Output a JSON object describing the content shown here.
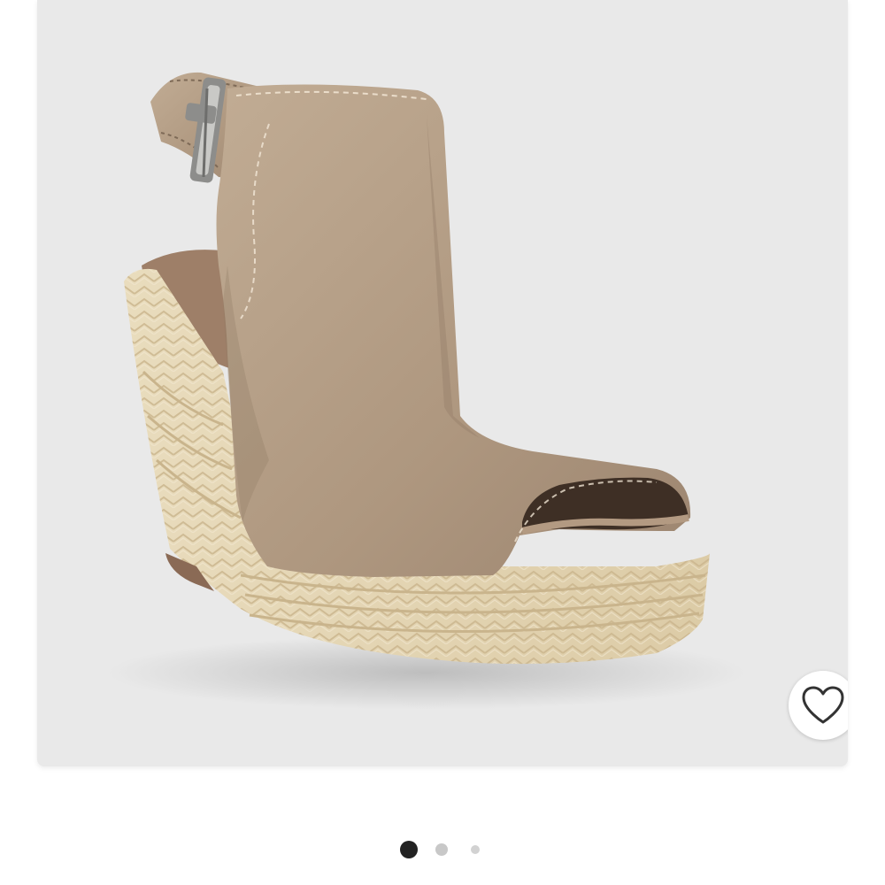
{
  "product": {
    "image_subject": "wedge-sandal",
    "colors": {
      "card_bg": "#e9e9e9",
      "suede": "#b49e86",
      "suede_dark": "#8f7964",
      "jute": "#e6d6b4",
      "jute_dark": "#cbb68e"
    }
  },
  "favorite": {
    "icon": "heart-outline-icon"
  },
  "carousel": {
    "total": 3,
    "active_index": 0
  }
}
